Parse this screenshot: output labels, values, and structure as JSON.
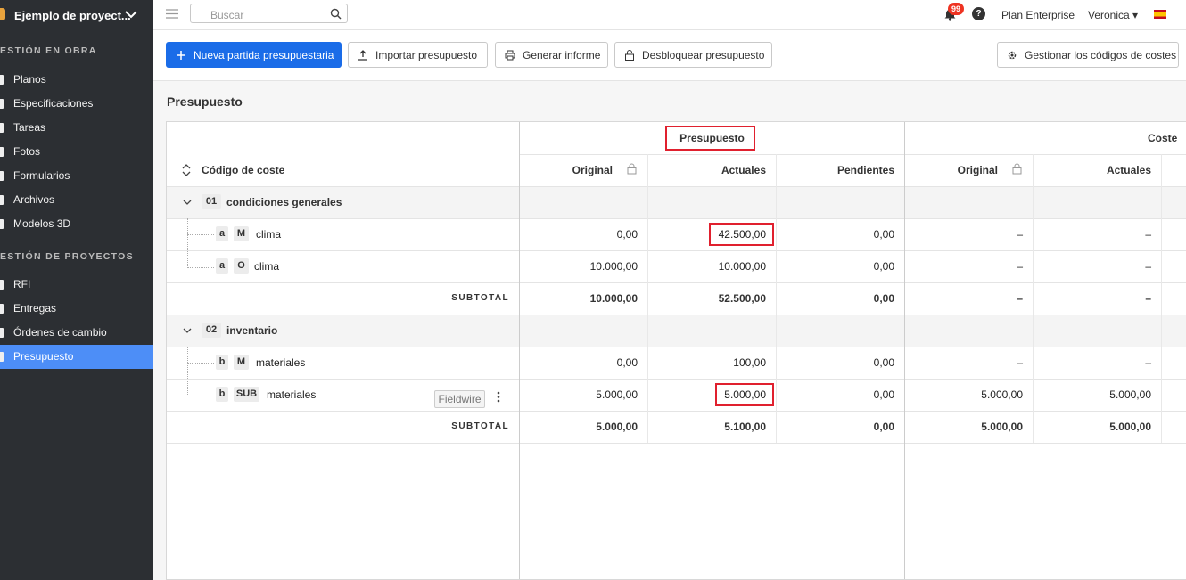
{
  "sidebar": {
    "project": "Ejemplo de proyect...",
    "section1": "ESTIÓN EN OBRA",
    "section2": "ESTIÓN DE PROYECTOS",
    "items": [
      {
        "label": "Planos"
      },
      {
        "label": "Especificaciones"
      },
      {
        "label": "Tareas"
      },
      {
        "label": "Fotos"
      },
      {
        "label": "Formularios"
      },
      {
        "label": "Archivos"
      },
      {
        "label": "Modelos 3D"
      },
      {
        "label": "RFI"
      },
      {
        "label": "Entregas"
      },
      {
        "label": "Órdenes de cambio"
      },
      {
        "label": "Presupuesto"
      }
    ]
  },
  "topbar": {
    "search_placeholder": "Buscar",
    "notifications": "99",
    "help": "?",
    "plan": "Plan Enterprise",
    "user": "Veronica ▾"
  },
  "toolbar": {
    "new": "Nueva partida presupuestaria",
    "import": "Importar presupuesto",
    "report": "Generar informe",
    "unlock": "Desbloquear presupuesto",
    "manage": "Gestionar los códigos de costes"
  },
  "page": {
    "title": "Presupuesto"
  },
  "table": {
    "group_presupuesto": "Presupuesto",
    "group_coste": "Coste",
    "col_code": "Código de coste",
    "col_original": "Original",
    "col_actuales": "Actuales",
    "col_pendientes": "Pendientes",
    "col_original2": "Original",
    "col_actuales2": "Actuales",
    "groups": [
      {
        "code": "01",
        "name": "condiciones generales",
        "rows": [
          {
            "letter": "a",
            "type": "M",
            "name": "clima",
            "original": "0,00",
            "actuales": "42.500,00",
            "pendientes": "0,00",
            "c_original": "–",
            "c_actuales": "–"
          },
          {
            "letter": "a",
            "type": "O",
            "name": "clima",
            "original": "10.000,00",
            "actuales": "10.000,00",
            "pendientes": "0,00",
            "c_original": "–",
            "c_actuales": "–"
          }
        ],
        "subtotal": {
          "label": "SUBTOTAL",
          "original": "10.000,00",
          "actuales": "52.500,00",
          "pendientes": "0,00",
          "c_original": "–",
          "c_actuales": "–"
        }
      },
      {
        "code": "02",
        "name": "inventario",
        "rows": [
          {
            "letter": "b",
            "type": "M",
            "name": "materiales",
            "original": "0,00",
            "actuales": "100,00",
            "pendientes": "0,00",
            "c_original": "–",
            "c_actuales": "–"
          },
          {
            "letter": "b",
            "type": "SUB",
            "name": "materiales",
            "badge": "Fieldwire",
            "original": "5.000,00",
            "actuales": "5.000,00",
            "pendientes": "0,00",
            "c_original": "5.000,00",
            "c_actuales": "5.000,00"
          }
        ],
        "subtotal": {
          "label": "SUBTOTAL",
          "original": "5.000,00",
          "actuales": "5.100,00",
          "pendientes": "0,00",
          "c_original": "5.000,00",
          "c_actuales": "5.000,00"
        }
      }
    ]
  },
  "colors": {
    "sidebar_bg": "#2c2f33",
    "active": "#4d8ef7",
    "primary": "#1a6ce8",
    "highlight": "#e0202e"
  }
}
